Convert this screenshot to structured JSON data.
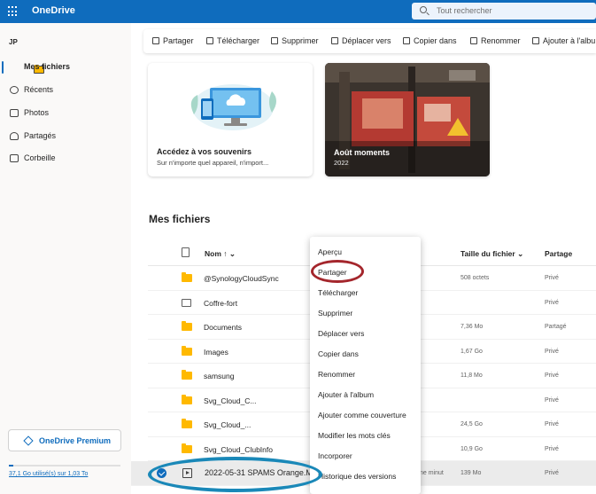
{
  "app": {
    "title": "OneDrive"
  },
  "search": {
    "placeholder": "Tout rechercher"
  },
  "user": {
    "initials": "JP"
  },
  "sidebar": {
    "items": [
      {
        "label": "Mes fichiers",
        "icon": "folder-icon",
        "active": true
      },
      {
        "label": "Récents",
        "icon": "clock-icon"
      },
      {
        "label": "Photos",
        "icon": "image-icon"
      },
      {
        "label": "Partagés",
        "icon": "people-icon"
      },
      {
        "label": "Corbeille",
        "icon": "trash-icon"
      }
    ],
    "premium_label": "OneDrive Premium",
    "storage": {
      "text": "37,1 Go utilisé(s) sur 1,03 To",
      "used_fraction": 0.036
    }
  },
  "toolbar": {
    "items": [
      "Partager",
      "Télécharger",
      "Supprimer",
      "Déplacer vers",
      "Copier dans",
      "Renommer",
      "Ajouter à l'albu"
    ]
  },
  "cards": [
    {
      "title": "Accédez à vos souvenirs",
      "subtitle": "Sur n'importe quel appareil, n'import..."
    },
    {
      "title": "Août moments",
      "subtitle": "2022"
    }
  ],
  "section_title": "Mes fichiers",
  "table": {
    "columns": {
      "name": "Nom ↑ ⌄",
      "size": "Taille du fichier ⌄",
      "sharing": "Partage"
    },
    "rows": [
      {
        "name": "@SynologyCloudSync",
        "type": "folder",
        "size": "508 octets",
        "sharing": "Privé"
      },
      {
        "name": "Coffre-fort",
        "type": "vault",
        "size": "",
        "sharing": "Privé"
      },
      {
        "name": "Documents",
        "type": "folder",
        "size": "7,36 Mo",
        "sharing": "Partagé"
      },
      {
        "name": "Images",
        "type": "folder",
        "size": "1,67 Go",
        "sharing": "Privé"
      },
      {
        "name": "samsung",
        "type": "folder",
        "size": "11,8 Mo",
        "sharing": "Privé"
      },
      {
        "name": "Svg_Cloud_C...",
        "type": "folder",
        "size": "",
        "sharing": "Privé"
      },
      {
        "name": "Svg_Cloud_...",
        "type": "folder",
        "size": "24,5 Go",
        "sharing": "Privé"
      },
      {
        "name": "Svg_Cloud_ClubInfo",
        "type": "folder",
        "size": "10,9 Go",
        "sharing": "Privé"
      },
      {
        "name": "2022-05-31 SPAMS Orange.M",
        "type": "video",
        "modified": "ne minut",
        "size": "139 Mo",
        "sharing": "Privé",
        "selected": true
      }
    ]
  },
  "context_menu": {
    "items": [
      "Aperçu",
      "Partager",
      "Télécharger",
      "Supprimer",
      "Déplacer vers",
      "Copier dans",
      "Renommer",
      "Ajouter à l'album",
      "Ajouter comme couverture",
      "Modifier les mots clés",
      "Incorporer",
      "Historique des versions"
    ]
  },
  "colors": {
    "accent": "#0f6cbd",
    "annotation_red": "#a4262c",
    "annotation_blue": "#1a88b8",
    "folder": "#ffb900"
  }
}
